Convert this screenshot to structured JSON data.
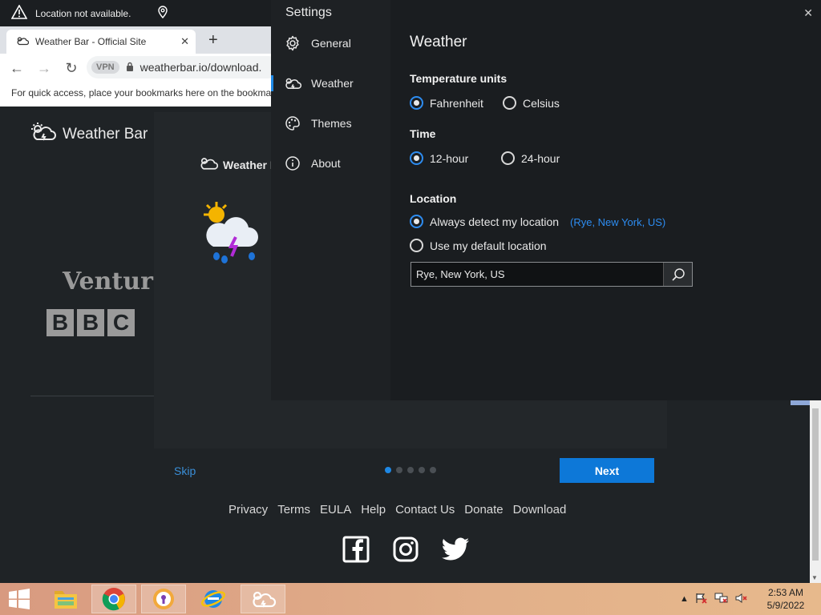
{
  "location_notice": {
    "text": "Location not available."
  },
  "browser": {
    "tab_title": "Weather Bar - Official Site",
    "vpn_label": "VPN",
    "url": "weatherbar.io/download.",
    "bookmark_hint": "For quick access, place your bookmarks here on the bookmar"
  },
  "site": {
    "logo_text": "Weather Bar",
    "press_ventur": "Ventur",
    "press_bbc": [
      "B",
      "B",
      "C"
    ],
    "onboard_logo_text": "Weather B",
    "skip_label": "Skip",
    "next_label": "Next",
    "dots": [
      true,
      false,
      false,
      false,
      false
    ],
    "footer_links": [
      "Privacy",
      "Terms",
      "EULA",
      "Help",
      "Contact Us",
      "Donate",
      "Download"
    ],
    "social": [
      "facebook-icon",
      "instagram-icon",
      "twitter-icon"
    ]
  },
  "settings": {
    "title": "Settings",
    "nav": [
      {
        "label": "General",
        "icon": "gear-icon",
        "selected": false
      },
      {
        "label": "Weather",
        "icon": "cloud-icon",
        "selected": true
      },
      {
        "label": "Themes",
        "icon": "palette-icon",
        "selected": false
      },
      {
        "label": "About",
        "icon": "info-icon",
        "selected": false
      }
    ],
    "pane_title": "Weather",
    "temp_label": "Temperature units",
    "temp_options": [
      "Fahrenheit",
      "Celsius"
    ],
    "temp_selected": "Fahrenheit",
    "time_label": "Time",
    "time_options": [
      "12-hour",
      "24-hour"
    ],
    "time_selected": "12-hour",
    "location_label": "Location",
    "location_options": [
      "Always detect my location",
      "Use my default location"
    ],
    "location_selected": "Always detect my location",
    "detected_location": "(Rye, New York, US)",
    "location_input_value": "Rye, New York, US",
    "accent_color": "#2d8cf0"
  },
  "taskbar": {
    "apps": [
      "windows-start-icon",
      "file-explorer-icon",
      "chrome-icon",
      "vpn-app-icon",
      "internet-explorer-icon",
      "weather-bar-icon"
    ],
    "clock_time": "2:53 AM",
    "clock_date": "5/9/2022"
  }
}
